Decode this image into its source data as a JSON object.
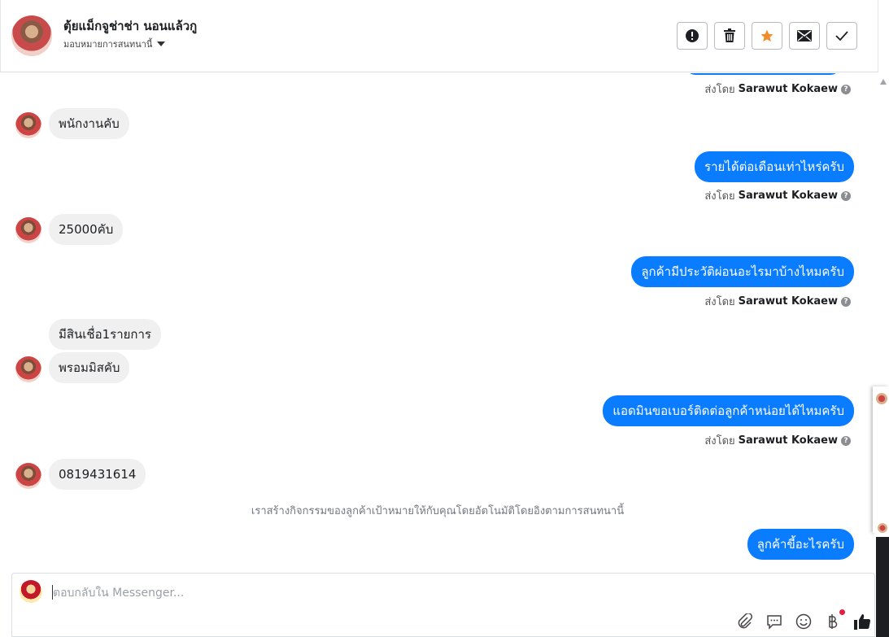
{
  "header": {
    "contact_name": "ตุ้ยแม็กจูช่าช่า นอนแล้วกู",
    "assign_label": "มอบหมายการสนทนานี้",
    "buttons": [
      "report-icon",
      "trash-icon",
      "star-icon",
      "mail-icon",
      "check-icon"
    ]
  },
  "colors": {
    "outgoing_bubble": "#0a7cff",
    "incoming_bubble": "#f0f0f0",
    "star": "#f28c28"
  },
  "sent_by": {
    "prefix": "ส่งโดย",
    "agent": "Sarawut Kokaew",
    "help": "?"
  },
  "messages": {
    "m1": "พนักงานคับ",
    "m2": "รายได้ต่อเดือนเท่าไหร่ครับ",
    "m3": "25000คับ",
    "m4": "ลูกค้ามีประวัติผ่อนอะไรมาบ้างไหมครับ",
    "m5": "มีสินเชื่อ1รายการ",
    "m6": "พรอมมิสคับ",
    "m7": "แอดมินขอเบอร์ติดต่อลูกค้าหน่อยได้ไหมครับ",
    "m8": "0819431614",
    "system": "เราสร้างกิจกรรมของลูกค้าเป้าหมายให้กับคุณโดยอัตโนมัติโดยอิงตามการสนทนานี้",
    "m9": "ลูกค้าขี้อะไรครับ"
  },
  "composer": {
    "placeholder": "ตอบกลับใน Messenger...",
    "icons": [
      "attachment-icon",
      "saved-reply-icon",
      "emoji-icon",
      "baht-icon",
      "like-icon"
    ]
  }
}
